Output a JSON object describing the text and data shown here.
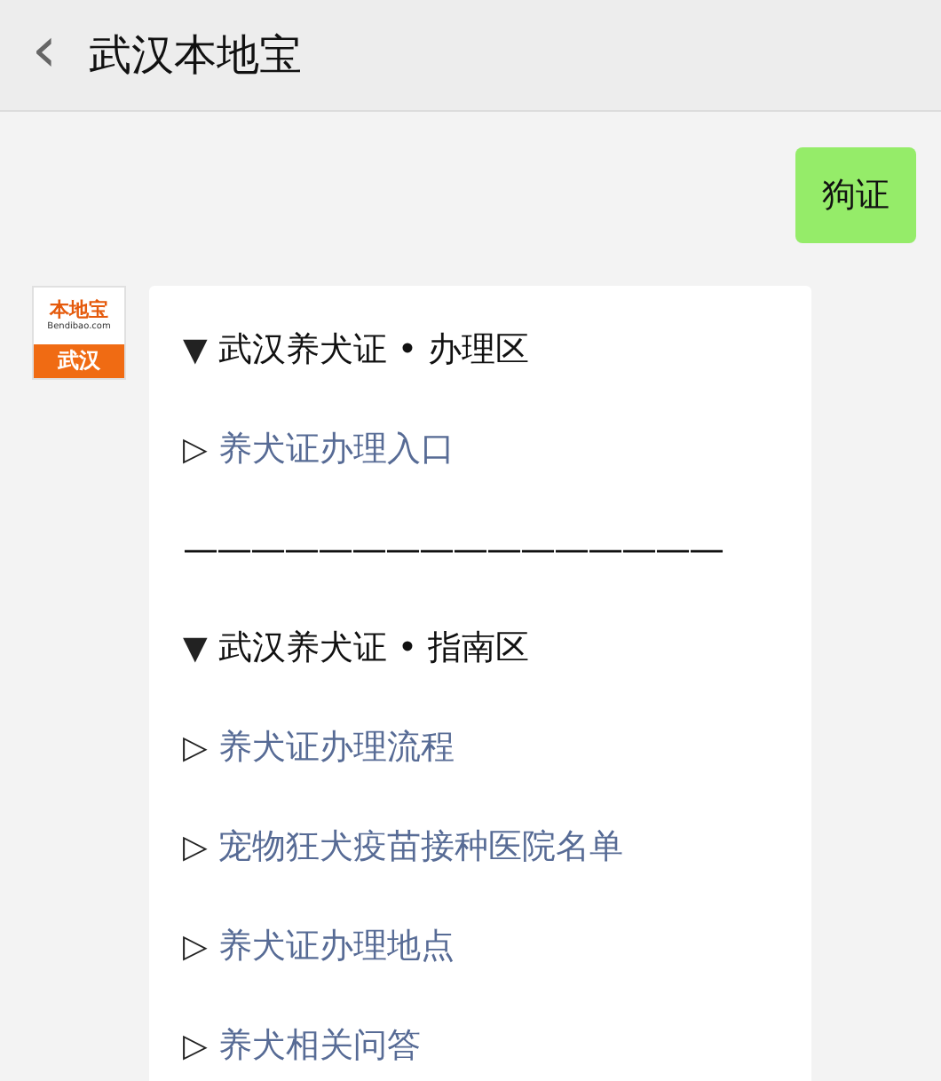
{
  "header": {
    "back_icon": "‹",
    "title": "武汉本地宝"
  },
  "messages": [
    {
      "kind": "sent",
      "text": "狗证"
    },
    {
      "kind": "received",
      "avatar": {
        "logo": "本地宝",
        "site": "Bendibao.com",
        "city": "武汉"
      },
      "lines": [
        {
          "kind": "heading",
          "marker": "▼",
          "text": "武汉养犬证 • 办理区"
        },
        {
          "kind": "link",
          "marker": "▷",
          "text": "养犬证办理入口"
        },
        {
          "kind": "divider",
          "text": "————————————————"
        },
        {
          "kind": "heading",
          "marker": "▼",
          "text": "武汉养犬证 • 指南区"
        },
        {
          "kind": "link",
          "marker": "▷",
          "text": "养犬证办理流程"
        },
        {
          "kind": "link",
          "marker": "▷",
          "text": "宠物狂犬疫苗接种医院名单"
        },
        {
          "kind": "link",
          "marker": "▷",
          "text": "养犬证办理地点"
        },
        {
          "kind": "link",
          "marker": "▷",
          "text": "养犬相关问答"
        }
      ]
    }
  ]
}
